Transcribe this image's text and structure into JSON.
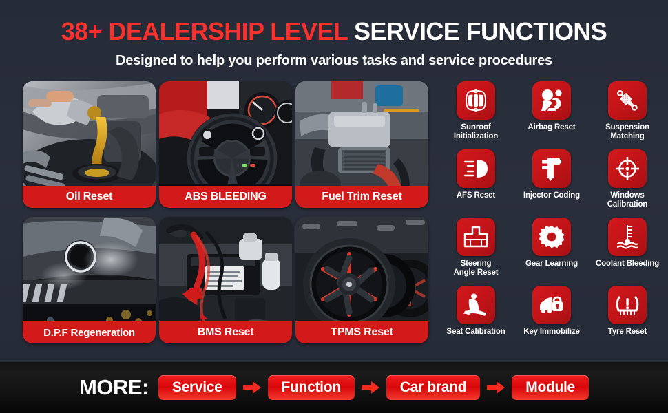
{
  "header": {
    "headline_red": "38+ DEALERSHIP LEVEL",
    "headline_white": "SERVICE FUNCTIONS",
    "subhead": "Designed to help you perform various tasks and service procedures"
  },
  "colors": {
    "background": "#262b38",
    "accent_red": "#f8312c",
    "tile_red": "#c31418",
    "caption_red": "#d21a1a",
    "bottom_bar": "#121212",
    "text_white": "#ffffff"
  },
  "cards": [
    {
      "label": "Oil Reset",
      "photo": "engine-oil-pouring"
    },
    {
      "label": "ABS BLEEDING",
      "photo": "steering-wheel-dashboard"
    },
    {
      "label": "Fuel Trim Reset",
      "photo": "engine-bay-intake"
    },
    {
      "label": "D.P.F Regeneration",
      "photo": "exhaust-tailpipe-smoke"
    },
    {
      "label": "BMS Reset",
      "photo": "battery-jumper-cables"
    },
    {
      "label": "TPMS Reset",
      "photo": "alloy-wheels-tyres"
    }
  ],
  "functions": [
    {
      "label": "Sunroof\nInitialization",
      "icon": "sunroof-car-icon"
    },
    {
      "label": "Airbag Reset",
      "icon": "airbag-icon"
    },
    {
      "label": "Suspension\nMatching",
      "icon": "shock-absorber-icon"
    },
    {
      "label": "AFS Reset",
      "icon": "headlamp-icon"
    },
    {
      "label": "Injector Coding",
      "icon": "fuel-injector-icon"
    },
    {
      "label": "Windows\nCalibration",
      "icon": "crosshair-target-icon"
    },
    {
      "label": "Steering\nAngle Reset",
      "icon": "steering-angle-icon"
    },
    {
      "label": "Gear Learning",
      "icon": "gear-icon"
    },
    {
      "label": "Coolant Bleeding",
      "icon": "coolant-thermometer-icon"
    },
    {
      "label": "Seat Calibration",
      "icon": "car-seat-icon"
    },
    {
      "label": "Key Immobilize",
      "icon": "car-lock-icon"
    },
    {
      "label": "Tyre Reset",
      "icon": "tpms-warning-icon"
    }
  ],
  "more_bar": {
    "label": "MORE:",
    "steps": [
      "Service",
      "Function",
      "Car brand",
      "Module"
    ],
    "separator_icon": "arrow-right-icon"
  }
}
